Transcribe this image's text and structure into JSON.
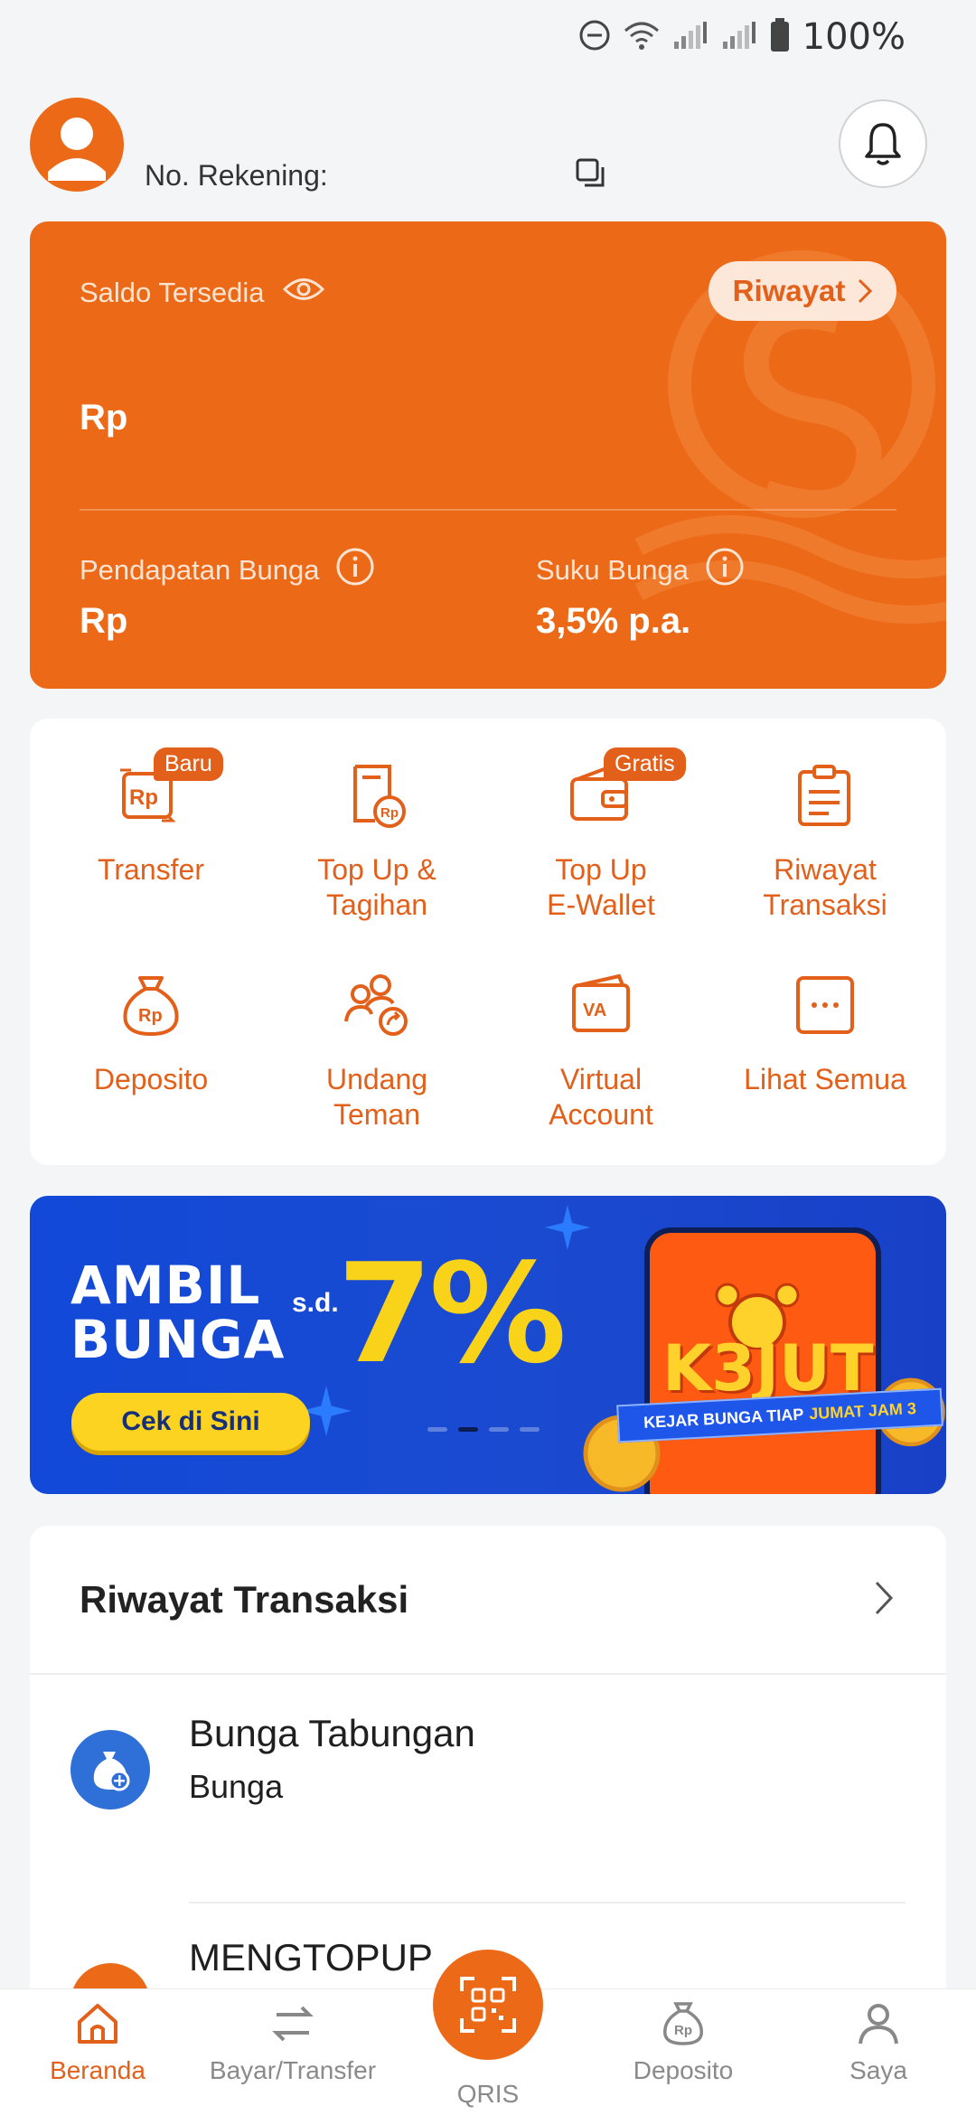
{
  "status_bar": {
    "battery_pct": "100%",
    "icons": [
      "dnd-icon",
      "wifi-icon",
      "signal-icon",
      "signal-icon",
      "battery-icon"
    ]
  },
  "header": {
    "account_label": "No. Rekening:",
    "icons": [
      "avatar-icon",
      "copy-icon",
      "bell-icon"
    ]
  },
  "balance": {
    "saldo_label": "Saldo Tersedia",
    "riwayat_label": "Riwayat",
    "amount": "Rp",
    "pendapatan_label": "Pendapatan Bunga",
    "pendapatan_value": "Rp",
    "suku_label": "Suku Bunga",
    "suku_value": "3,5% p.a.",
    "accent": "#ec6a17"
  },
  "menu": {
    "items": [
      {
        "label": "Transfer",
        "icon": "transfer-rp-icon",
        "badge": "Baru"
      },
      {
        "label": "Top Up &\nTagihan",
        "icon": "bill-rp-icon"
      },
      {
        "label": "Top Up\nE-Wallet",
        "icon": "wallet-icon",
        "badge": "Gratis"
      },
      {
        "label": "Riwayat\nTransaksi",
        "icon": "clipboard-icon"
      },
      {
        "label": "Deposito",
        "icon": "money-bag-icon"
      },
      {
        "label": "Undang\nTeman",
        "icon": "invite-friends-icon"
      },
      {
        "label": "Virtual\nAccount",
        "icon": "virtual-account-icon"
      },
      {
        "label": "Lihat Semua",
        "icon": "more-icon"
      }
    ]
  },
  "banner": {
    "line1": "AMBIL",
    "line2": "BUNGA",
    "sd": "s.d.",
    "percent": "7%",
    "cta": "Cek di Sini",
    "promo_big": "K3JUT",
    "ribbon_text": "KEJAR BUNGA TIAP",
    "ribbon_highlight": "JUMAT JAM 3"
  },
  "transactions": {
    "title": "Riwayat Transaksi",
    "rows": [
      {
        "name": "Bunga Tabungan",
        "sub": "Bunga",
        "icon": "savings-bag-icon"
      },
      {
        "name": "MENGTOPUP",
        "sub": "",
        "icon": "topup-icon"
      }
    ]
  },
  "bottom_nav": {
    "items": [
      {
        "label": "Beranda",
        "icon": "home-icon",
        "active": true
      },
      {
        "label": "Bayar/Transfer",
        "icon": "swap-icon"
      },
      {
        "label": "QRIS",
        "icon": "qris-icon"
      },
      {
        "label": "Deposito",
        "icon": "deposito-icon"
      },
      {
        "label": "Saya",
        "icon": "profile-icon"
      }
    ]
  }
}
